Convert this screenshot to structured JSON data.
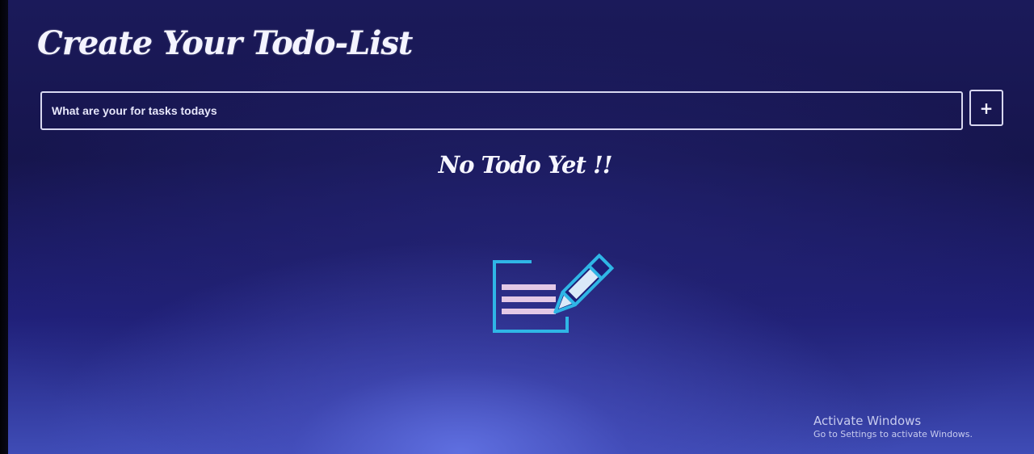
{
  "header": {
    "title": "Create Your Todo-List"
  },
  "task_form": {
    "placeholder": "What are your for tasks todays",
    "value": "",
    "add_label": "+"
  },
  "empty_state": {
    "message": "No Todo Yet !!",
    "icon": "note-edit-icon"
  },
  "watermark": {
    "title": "Activate Windows",
    "subtitle": "Go to Settings to activate Windows."
  },
  "colors": {
    "background": "#1b1a5a",
    "text": "#f4f4ff",
    "icon_outline": "#2fb6e6",
    "icon_lines": "#e3c9e6"
  }
}
